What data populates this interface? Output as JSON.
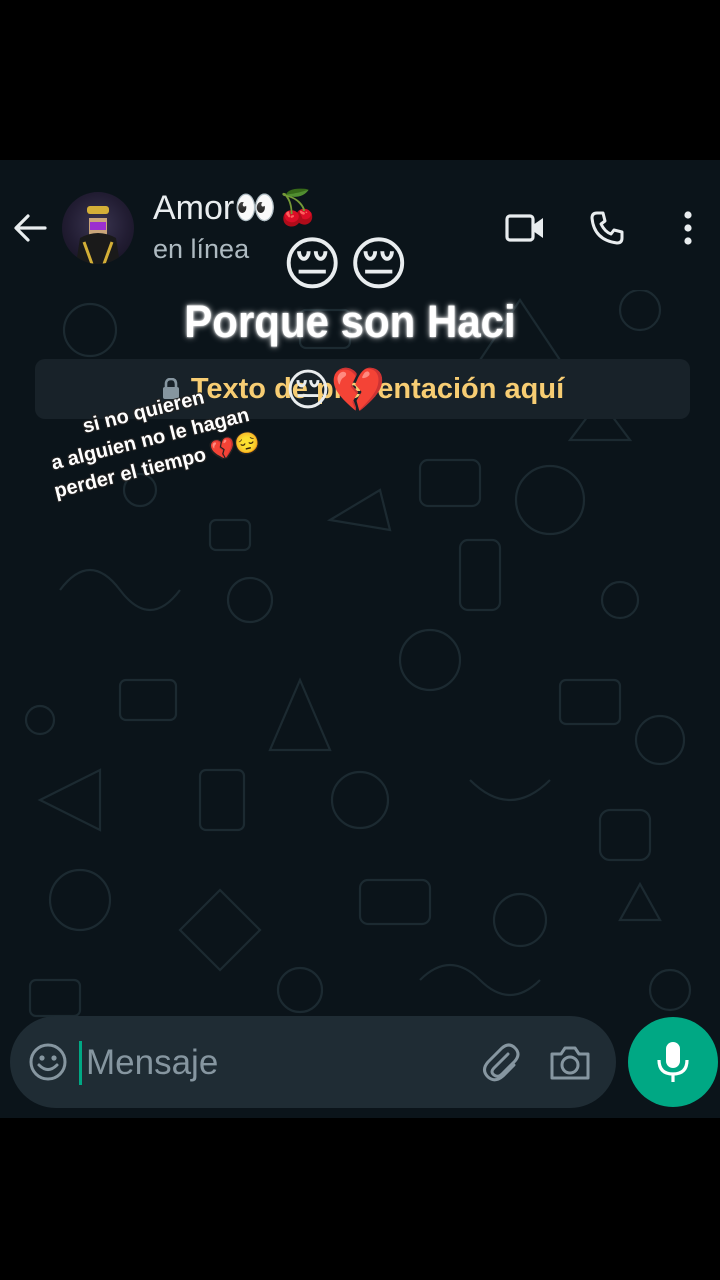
{
  "header": {
    "contact_name": "Amor👀🍒",
    "status": "en línea",
    "icons": [
      "back-arrow-icon",
      "video-call-icon",
      "phone-icon",
      "more-vert-icon"
    ]
  },
  "overlay": {
    "emojis": "😔😔",
    "caption": "Porque son Haci"
  },
  "notice": {
    "text": "Texto de presentación aquí",
    "icon": "lock-icon",
    "emojis": "😔💔"
  },
  "sticker": {
    "lines": [
      "si no quieren",
      "a alguien no le hagan",
      "perder el tiempo 💔😔"
    ]
  },
  "composer": {
    "placeholder": "Mensaje",
    "icons": [
      "emoji-icon",
      "attach-icon",
      "camera-icon",
      "mic-icon"
    ]
  },
  "colors": {
    "chat_background": "#0b141a",
    "accent": "#00a884",
    "notice_text": "#f7cd73",
    "input_bar": "#1f2c34"
  }
}
